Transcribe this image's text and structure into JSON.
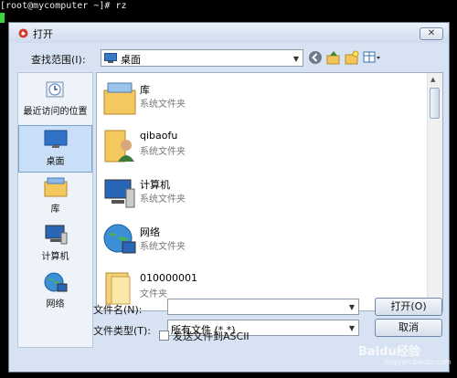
{
  "terminal": {
    "prompt_line": "[root@mycomputer ~]# rz"
  },
  "dialog": {
    "title": "打开",
    "close_label": "✕",
    "lookin_label": "查找范围(I):",
    "lookin_value": "桌面",
    "toolbar": {
      "view_arrow": "▾"
    },
    "places": [
      {
        "label": "最近访问的位置"
      },
      {
        "label": "桌面"
      },
      {
        "label": "库"
      },
      {
        "label": "计算机"
      },
      {
        "label": "网络"
      }
    ],
    "items": [
      {
        "name": "库",
        "type": "系统文件夹"
      },
      {
        "name": "qibaofu",
        "type": "系统文件夹"
      },
      {
        "name": "计算机",
        "type": "系统文件夹"
      },
      {
        "name": "网络",
        "type": "系统文件夹"
      },
      {
        "name": "010000001",
        "type": "文件夹"
      }
    ],
    "filename_label": "文件名(N):",
    "filename_value": "",
    "filetype_label": "文件类型(T):",
    "filetype_value": "所有文件 (*.*)",
    "open_label": "打开(O)",
    "cancel_label": "取消",
    "ascii_label": "发送文件到ASCII",
    "ascii_checked": false
  },
  "watermark": {
    "main": "Baidu经验",
    "sub": "jingyan.baidu.com"
  },
  "colors": {
    "selection": "#c9dff7",
    "dialog_bg": "#d7e3f2"
  }
}
